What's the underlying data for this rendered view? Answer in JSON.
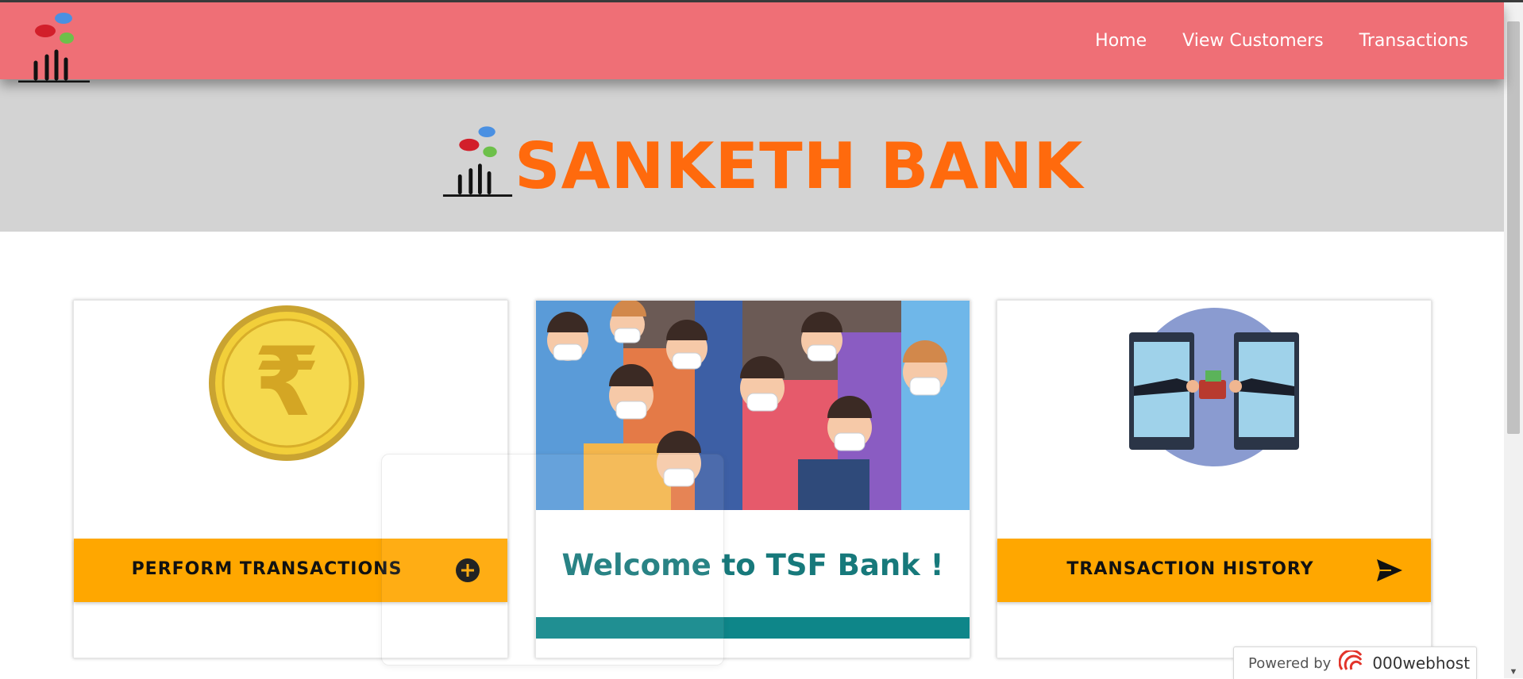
{
  "nav": {
    "links": [
      "Home",
      "View Customers",
      "Transactions"
    ]
  },
  "hero": {
    "title": "SANKETH BANK"
  },
  "cards": {
    "perform": {
      "label": "PERFORM TRANSACTIONS"
    },
    "welcome": {
      "text": "Welcome to TSF Bank !"
    },
    "history": {
      "label": "TRANSACTION HISTORY"
    }
  },
  "footer": {
    "powered_text": "Powered by",
    "brand": "000webhost"
  },
  "colors": {
    "navbar": "#ef6f76",
    "hero_title": "#ff6a0d",
    "button": "#ffa700",
    "welcome": "#17797b",
    "teal_bar": "#0e8689"
  }
}
